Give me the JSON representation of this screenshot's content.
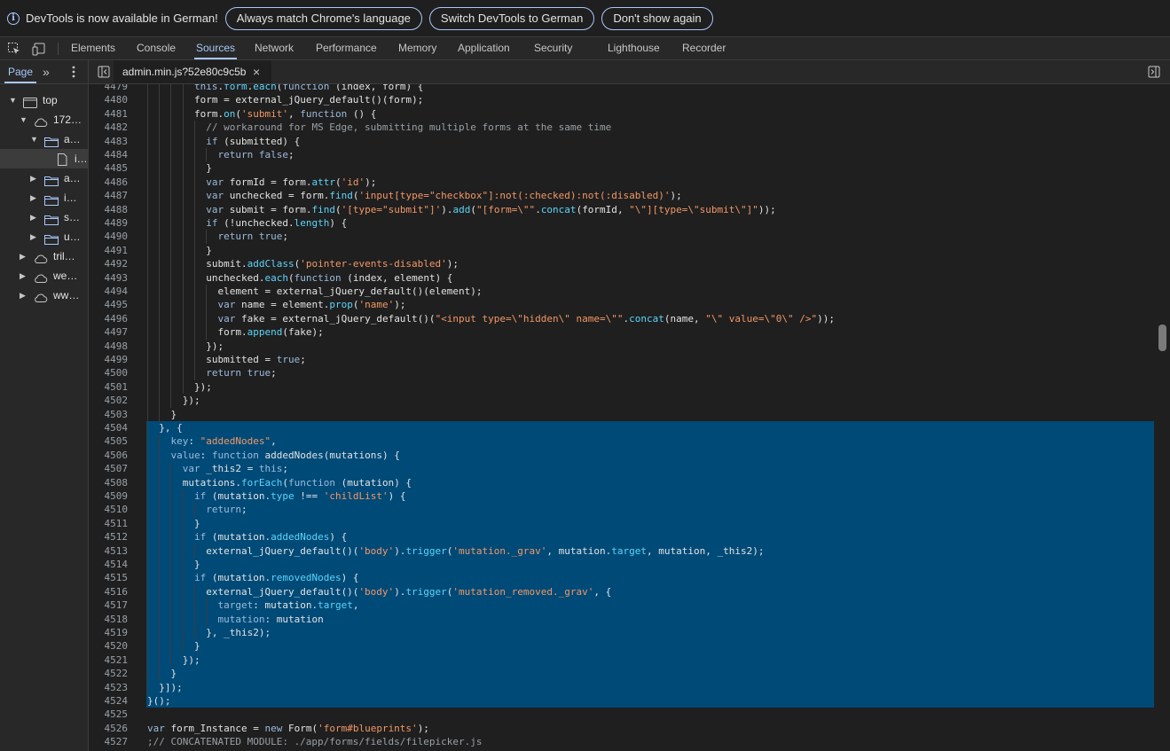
{
  "infobar": {
    "message": "DevTools is now available in German!",
    "buttons": [
      "Always match Chrome's language",
      "Switch DevTools to German",
      "Don't show again"
    ]
  },
  "tabs": [
    "Elements",
    "Console",
    "Sources",
    "Network",
    "Performance",
    "Memory",
    "Application",
    "Security",
    "Lighthouse",
    "Recorder"
  ],
  "active_tab": "Sources",
  "sidebar": {
    "tab": "Page",
    "tree": [
      {
        "label": "top",
        "icon": "frame-icon",
        "arrow": "down"
      },
      {
        "label": "172…",
        "icon": "cloud-icon",
        "arrow": "down"
      },
      {
        "label": "a…",
        "icon": "folder-icon",
        "arrow": "down"
      },
      {
        "label": "i…",
        "icon": "file-icon",
        "arrow": ""
      },
      {
        "label": "a…",
        "icon": "folder-icon",
        "arrow": "right"
      },
      {
        "label": "i…",
        "icon": "folder-icon",
        "arrow": "right"
      },
      {
        "label": "s…",
        "icon": "folder-icon",
        "arrow": "right"
      },
      {
        "label": "u…",
        "icon": "folder-icon",
        "arrow": "right"
      },
      {
        "label": "tril…",
        "icon": "cloud-icon",
        "arrow": "right"
      },
      {
        "label": "we…",
        "icon": "cloud-icon",
        "arrow": "right"
      },
      {
        "label": "ww…",
        "icon": "cloud-icon",
        "arrow": "right"
      }
    ]
  },
  "file_tab": {
    "name": "admin.min.js?52e80c9c5b"
  },
  "colors": {
    "keyword": "#9bbbdc",
    "string": "#f29766",
    "comment": "#9aa0a6",
    "function": "#5cd5fb",
    "text": "#e3e3e3",
    "selection": "#004a77"
  },
  "code_lines": [
    {
      "n": "4479",
      "ind": 4,
      "hl": false,
      "t": "this.form.each(function (index, form) {"
    },
    {
      "n": "4480",
      "ind": 4,
      "hl": false,
      "t": "  form = external_jQuery_default()(form);"
    },
    {
      "n": "4481",
      "ind": 4,
      "hl": false,
      "t": "  form.on('submit', function () {"
    },
    {
      "n": "4482",
      "ind": 5,
      "hl": false,
      "t": "    // workaround for MS Edge, submitting multiple forms at the same time"
    },
    {
      "n": "4483",
      "ind": 5,
      "hl": false,
      "t": "    if (submitted) {"
    },
    {
      "n": "4484",
      "ind": 6,
      "hl": false,
      "t": "      return false;"
    },
    {
      "n": "4485",
      "ind": 5,
      "hl": false,
      "t": "    }"
    },
    {
      "n": "4486",
      "ind": 5,
      "hl": false,
      "t": "    var formId = form.attr('id');"
    },
    {
      "n": "4487",
      "ind": 5,
      "hl": false,
      "t": "    var unchecked = form.find('input[type=\"checkbox\"]:not(:checked):not(:disabled)');"
    },
    {
      "n": "4488",
      "ind": 5,
      "hl": false,
      "t": "    var submit = form.find('[type=\"submit\"]').add(\"[form=\\\"\".concat(formId, \"\\\"][type=\\\"submit\\\"]\"));"
    },
    {
      "n": "4489",
      "ind": 5,
      "hl": false,
      "t": "    if (!unchecked.length) {"
    },
    {
      "n": "4490",
      "ind": 6,
      "hl": false,
      "t": "      return true;"
    },
    {
      "n": "4491",
      "ind": 5,
      "hl": false,
      "t": "    }"
    },
    {
      "n": "4492",
      "ind": 5,
      "hl": false,
      "t": "    submit.addClass('pointer-events-disabled');"
    },
    {
      "n": "4493",
      "ind": 5,
      "hl": false,
      "t": "    unchecked.each(function (index, element) {"
    },
    {
      "n": "4494",
      "ind": 6,
      "hl": false,
      "t": "      element = external_jQuery_default()(element);"
    },
    {
      "n": "4495",
      "ind": 6,
      "hl": false,
      "t": "      var name = element.prop('name');"
    },
    {
      "n": "4496",
      "ind": 6,
      "hl": false,
      "t": "      var fake = external_jQuery_default()(\"<input type=\\\"hidden\\\" name=\\\"\".concat(name, \"\\\" value=\\\"0\\\" />\"));"
    },
    {
      "n": "4497",
      "ind": 6,
      "hl": false,
      "t": "      form.append(fake);"
    },
    {
      "n": "4498",
      "ind": 5,
      "hl": false,
      "t": "    });"
    },
    {
      "n": "4499",
      "ind": 5,
      "hl": false,
      "t": "    submitted = true;"
    },
    {
      "n": "4500",
      "ind": 5,
      "hl": false,
      "t": "    return true;"
    },
    {
      "n": "4501",
      "ind": 4,
      "hl": false,
      "t": "  });"
    },
    {
      "n": "4502",
      "ind": 3,
      "hl": false,
      "t": "});"
    },
    {
      "n": "4503",
      "ind": 2,
      "hl": false,
      "t": "}"
    },
    {
      "n": "4504",
      "ind": 1,
      "hl": true,
      "t": "}, {"
    },
    {
      "n": "4505",
      "ind": 2,
      "hl": true,
      "t": "  key: \"addedNodes\","
    },
    {
      "n": "4506",
      "ind": 2,
      "hl": true,
      "t": "  value: function addedNodes(mutations) {"
    },
    {
      "n": "4507",
      "ind": 3,
      "hl": true,
      "t": "    var _this2 = this;"
    },
    {
      "n": "4508",
      "ind": 3,
      "hl": true,
      "t": "    mutations.forEach(function (mutation) {"
    },
    {
      "n": "4509",
      "ind": 4,
      "hl": true,
      "t": "      if (mutation.type !== 'childList') {"
    },
    {
      "n": "4510",
      "ind": 5,
      "hl": true,
      "t": "        return;"
    },
    {
      "n": "4511",
      "ind": 4,
      "hl": true,
      "t": "      }"
    },
    {
      "n": "4512",
      "ind": 4,
      "hl": true,
      "t": "      if (mutation.addedNodes) {"
    },
    {
      "n": "4513",
      "ind": 5,
      "hl": true,
      "t": "        external_jQuery_default()('body').trigger('mutation._grav', mutation.target, mutation, _this2);"
    },
    {
      "n": "4514",
      "ind": 4,
      "hl": true,
      "t": "      }"
    },
    {
      "n": "4515",
      "ind": 4,
      "hl": true,
      "t": "      if (mutation.removedNodes) {"
    },
    {
      "n": "4516",
      "ind": 5,
      "hl": true,
      "t": "        external_jQuery_default()('body').trigger('mutation_removed._grav', {"
    },
    {
      "n": "4517",
      "ind": 6,
      "hl": true,
      "t": "          target: mutation.target,"
    },
    {
      "n": "4518",
      "ind": 6,
      "hl": true,
      "t": "          mutation: mutation"
    },
    {
      "n": "4519",
      "ind": 5,
      "hl": true,
      "t": "        }, _this2);"
    },
    {
      "n": "4520",
      "ind": 4,
      "hl": true,
      "t": "      }"
    },
    {
      "n": "4521",
      "ind": 3,
      "hl": true,
      "t": "    });"
    },
    {
      "n": "4522",
      "ind": 2,
      "hl": true,
      "t": "  }"
    },
    {
      "n": "4523",
      "ind": 1,
      "hl": true,
      "t": "}]);"
    },
    {
      "n": "4524",
      "ind": 0,
      "hl": true,
      "t": "}();"
    },
    {
      "n": "4525",
      "ind": 0,
      "hl": false,
      "t": ""
    },
    {
      "n": "4526",
      "ind": 0,
      "hl": false,
      "t": "var form_Instance = new Form('form#blueprints');"
    },
    {
      "n": "4527",
      "ind": 0,
      "hl": false,
      "t": ";// CONCATENATED MODULE: ./app/forms/fields/filepicker.js"
    }
  ]
}
